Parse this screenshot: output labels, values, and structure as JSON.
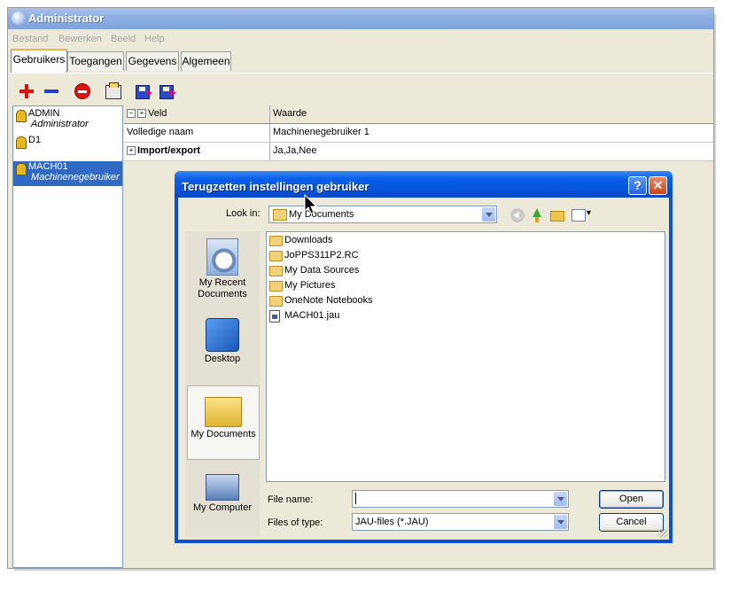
{
  "window": {
    "title": "Administrator"
  },
  "menu": [
    "Bestand",
    "Bewerken",
    "Beeld",
    "Help"
  ],
  "tabs": [
    "Gebruikers",
    "Toegangen",
    "Gegevens",
    "Algemeen"
  ],
  "users": [
    {
      "name": "ADMIN",
      "role": "Administrator"
    },
    {
      "name": "D1",
      "role": ""
    },
    {
      "name": "MACH01",
      "role": "Machinenegebruiker"
    }
  ],
  "grid": {
    "col_field": "Veld",
    "col_value": "Waarde",
    "rows": [
      {
        "field": "Volledige naam",
        "value": "Machinenegebruiker 1"
      },
      {
        "field": "Import/export",
        "value": "Ja,Ja,Nee"
      }
    ]
  },
  "dialog": {
    "title": "Terugzetten instellingen gebruiker",
    "lookin_label": "Look in:",
    "lookin_value": "My Documents",
    "places": [
      "My Recent Documents",
      "Desktop",
      "My Documents",
      "My Computer"
    ],
    "files": [
      "Downloads",
      "JoPPS311P2.RC",
      "My Data Sources",
      "My Pictures",
      "OneNote Notebooks",
      "MACH01.jau"
    ],
    "filename_label": "File name:",
    "filename_value": "",
    "filetype_label": "Files of type:",
    "filetype_value": "JAU-files (*.JAU)",
    "open_label": "Open",
    "cancel_label": "Cancel",
    "help_glyph": "?",
    "close_glyph": "✕"
  }
}
